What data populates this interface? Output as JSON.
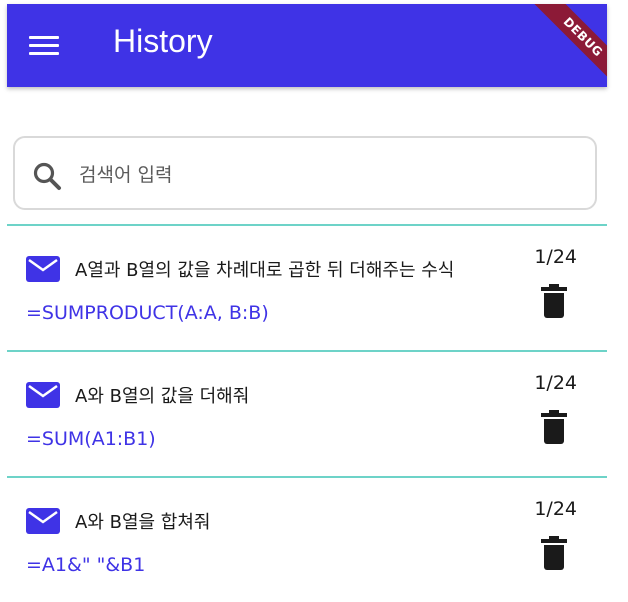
{
  "appbar": {
    "title": "History",
    "debug_label": "DEBUG",
    "color": "#3f33e6"
  },
  "search": {
    "placeholder": "검색어 입력",
    "value": "",
    "icon": "search-icon"
  },
  "history": {
    "items": [
      {
        "description": "A열과 B열의 값을 차례대로 곱한 뒤 더해주는 수식",
        "formula": "=SUMPRODUCT(A:A, B:B)",
        "date": "1/24",
        "icon": "mail-icon"
      },
      {
        "description": "A와 B열의 값을 더해줘",
        "formula": "=SUM(A1:B1)",
        "date": "1/24",
        "icon": "mail-icon"
      },
      {
        "description": "A와 B열을 합쳐줘",
        "formula": "=A1&\" \"&B1",
        "date": "1/24",
        "icon": "mail-icon"
      }
    ]
  }
}
